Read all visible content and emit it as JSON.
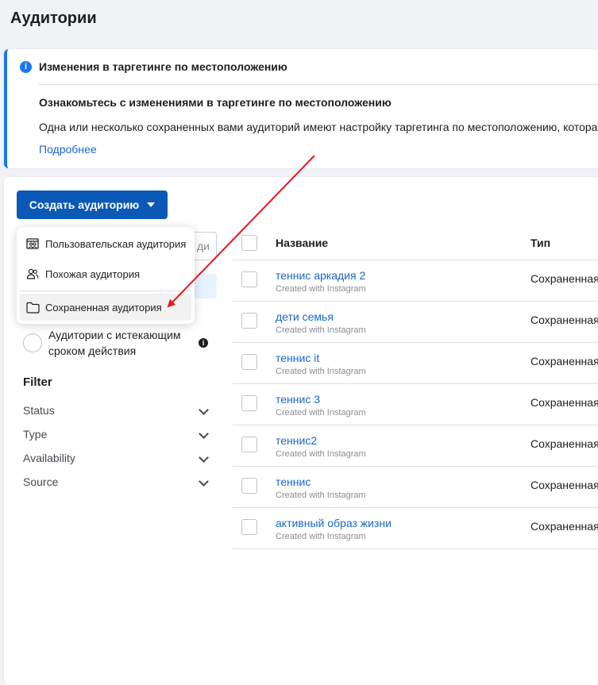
{
  "page": {
    "title": "Аудитории"
  },
  "notice": {
    "title": "Изменения в таргетинге по местоположению",
    "subtitle": "Ознакомьтесь с изменениями в таргетинге по местоположению",
    "body": "Одна или несколько сохраненных вами аудиторий имеют настройку таргетинга по местоположению, которая",
    "link": "Подробнее",
    "accent_color": "#1877f2"
  },
  "toolbar": {
    "create_label": "Создать аудиторию",
    "button_color": "#0b59b6"
  },
  "search": {
    "visible_fragment": "ди"
  },
  "create_menu": {
    "items": [
      {
        "label": "Пользовательская аудитория",
        "icon": "custom-audience-icon"
      },
      {
        "label": "Похожая аудитория",
        "icon": "people-icon"
      },
      {
        "label": "Сохраненная аудитория",
        "icon": "folder-icon"
      }
    ]
  },
  "sidebar": {
    "expiring_label": "Аудитории с истекающим сроком действия",
    "filter_title": "Filter",
    "filters": [
      "Status",
      "Type",
      "Availability",
      "Source"
    ]
  },
  "table": {
    "headers": {
      "name": "Название",
      "type": "Тип"
    },
    "rows": [
      {
        "name": "теннис аркадия 2",
        "source": "Created with Instagram",
        "type": "Сохраненная"
      },
      {
        "name": "дети семья",
        "source": "Created with Instagram",
        "type": "Сохраненная"
      },
      {
        "name": "теннис it",
        "source": "Created with Instagram",
        "type": "Сохраненная"
      },
      {
        "name": "теннис 3",
        "source": "Created with Instagram",
        "type": "Сохраненная"
      },
      {
        "name": "теннис2",
        "source": "Created with Instagram",
        "type": "Сохраненная"
      },
      {
        "name": "теннис",
        "source": "Created with Instagram",
        "type": "Сохраненная"
      },
      {
        "name": "активный образ жизни",
        "source": "Created with Instagram",
        "type": "Сохраненная"
      }
    ]
  },
  "annotation": {
    "arrow_color": "#e8161b"
  }
}
